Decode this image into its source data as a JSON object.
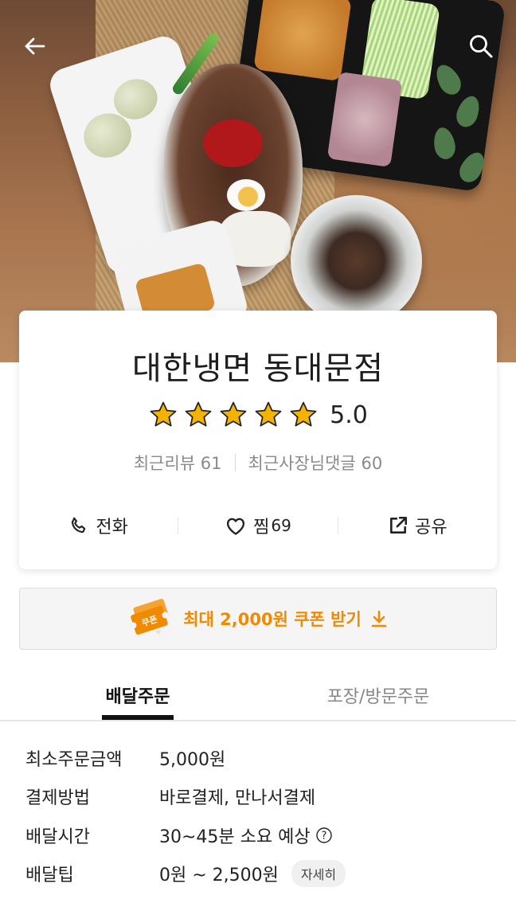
{
  "header": {
    "back_icon": "arrow-left-icon",
    "search_icon": "search-icon"
  },
  "store": {
    "name": "대한냉면 동대문점",
    "rating": "5.0",
    "stars": 5,
    "recent_reviews_label": "최근리뷰",
    "recent_reviews_count": "61",
    "owner_replies_label": "최근사장님댓글",
    "owner_replies_count": "60",
    "accent_color": "#f08a00",
    "star_color": "#f5b301"
  },
  "actions": {
    "call_label": "전화",
    "like_label": "찜",
    "like_count": "69",
    "share_label": "공유"
  },
  "coupon": {
    "badge_text": "쿠폰",
    "text": "최대 2,000원 쿠폰 받기"
  },
  "tabs": [
    {
      "label": "배달주문",
      "active": true
    },
    {
      "label": "포장/방문주문",
      "active": false
    }
  ],
  "info": [
    {
      "label": "최소주문금액",
      "value": "5,000원"
    },
    {
      "label": "결제방법",
      "value": "바로결제, 만나서결제"
    },
    {
      "label": "배달시간",
      "value": "30~45분 소요 예상"
    },
    {
      "label": "배달팁",
      "value": "0원 ~ 2,500원",
      "button": "자세히"
    }
  ]
}
